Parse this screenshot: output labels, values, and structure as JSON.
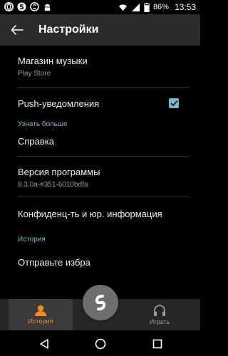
{
  "status_bar": {
    "battery_percent": "86%",
    "time": "13:53",
    "icons": [
      "opera-icon",
      "s-icon",
      "shazam-icon",
      "android-icon",
      "wifi-icon",
      "signal-icon",
      "battery-icon"
    ]
  },
  "header": {
    "title": "Настройки",
    "back_icon": "arrow-left-icon"
  },
  "settings": {
    "music_store": {
      "label": "Магазин музыки",
      "value": "Play Store"
    },
    "push": {
      "label": "Push-уведомления",
      "checked": true
    },
    "learn_more_header": "Узнать больше",
    "help": {
      "label": "Справка"
    },
    "version": {
      "label": "Версия программы",
      "value": "8.3.0a-#351-6010bdfa"
    },
    "privacy": {
      "label": "Конфиденц-ть и юр. информация"
    },
    "history_header": "История",
    "send_favorites": {
      "label": "Отправьте избра"
    }
  },
  "tabs": [
    {
      "label": "История",
      "icon": "person-icon",
      "active": true
    },
    {
      "label": "Играть",
      "icon": "headphones-icon",
      "active": false
    }
  ],
  "fab": {
    "icon": "shazam-logo-icon"
  },
  "navbar": {
    "icons": [
      "back-triangle-icon",
      "home-circle-icon",
      "recents-square-icon"
    ]
  },
  "colors": {
    "accent_teal": "#7fb7c6",
    "accent_orange": "#f08c1a",
    "appbar": "#2b2b2b"
  }
}
